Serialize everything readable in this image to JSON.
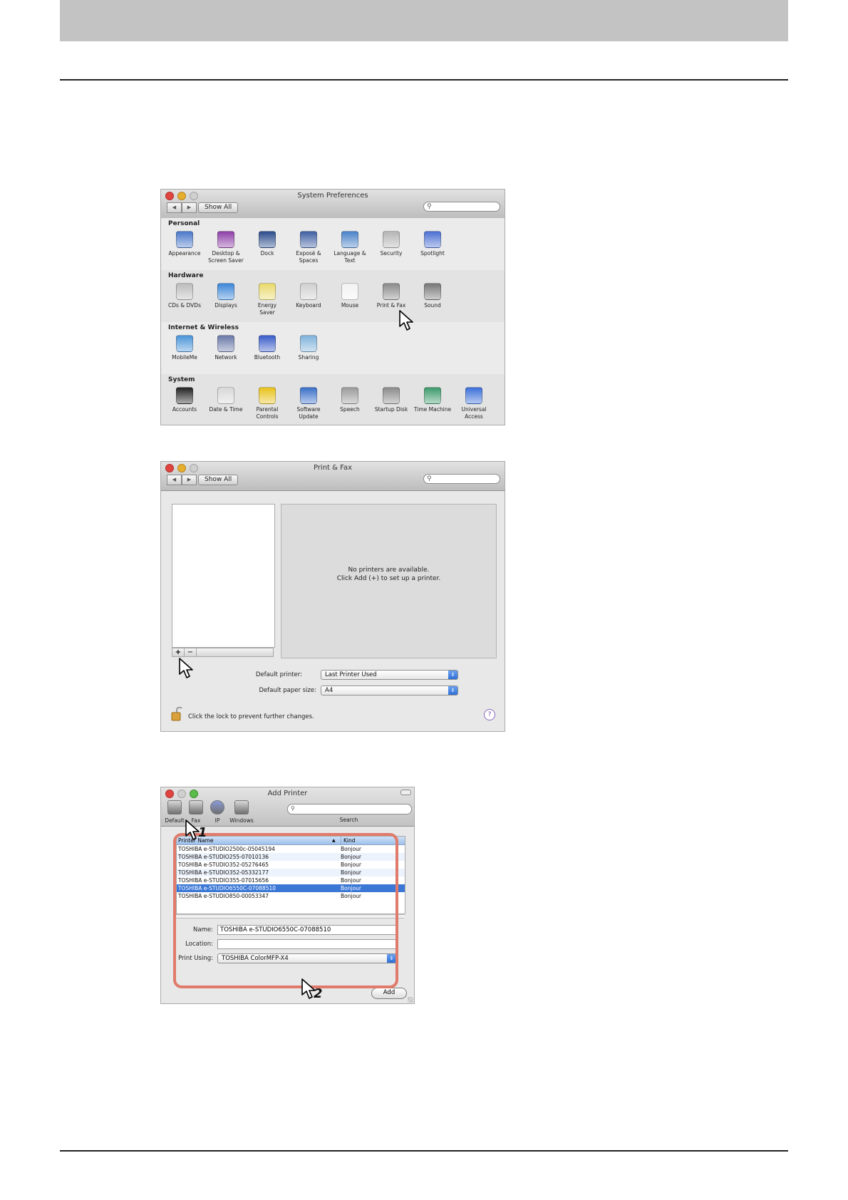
{
  "sys_prefs": {
    "title": "System Preferences",
    "show_all": "Show All",
    "sections": [
      {
        "name": "Personal",
        "items": [
          {
            "label": "Appearance",
            "icon": "appearance-icon",
            "color": "#4a78c8"
          },
          {
            "label": "Desktop &\nScreen Saver",
            "icon": "desktop-icon",
            "color": "#8e3fa8"
          },
          {
            "label": "Dock",
            "icon": "dock-icon",
            "color": "#2b4c8c"
          },
          {
            "label": "Exposé &\nSpaces",
            "icon": "expose-icon",
            "color": "#3f5fa3"
          },
          {
            "label": "Language &\nText",
            "icon": "flag-icon",
            "color": "#4a82c8"
          },
          {
            "label": "Security",
            "icon": "house-lock-icon",
            "color": "#b5b5b5"
          },
          {
            "label": "Spotlight",
            "icon": "spotlight-icon",
            "color": "#4b70d2"
          }
        ]
      },
      {
        "name": "Hardware",
        "items": [
          {
            "label": "CDs & DVDs",
            "icon": "disc-icon",
            "color": "#bcbcbc"
          },
          {
            "label": "Displays",
            "icon": "display-icon",
            "color": "#3b86d8"
          },
          {
            "label": "Energy\nSaver",
            "icon": "bulb-icon",
            "color": "#e8d96a"
          },
          {
            "label": "Keyboard",
            "icon": "keyboard-icon",
            "color": "#cfcfcf"
          },
          {
            "label": "Mouse",
            "icon": "mouse-icon",
            "color": "#f2f2f2"
          },
          {
            "label": "Print & Fax",
            "icon": "printer-icon",
            "color": "#8a8a8a"
          },
          {
            "label": "Sound",
            "icon": "speaker-icon",
            "color": "#777777"
          }
        ]
      },
      {
        "name": "Internet & Wireless",
        "items": [
          {
            "label": "MobileMe",
            "icon": "cloud-icon",
            "color": "#4a95d8"
          },
          {
            "label": "Network",
            "icon": "globe-icon",
            "color": "#6a78a8"
          },
          {
            "label": "Bluetooth",
            "icon": "bluetooth-icon",
            "color": "#3a5cc8"
          },
          {
            "label": "Sharing",
            "icon": "folder-icon",
            "color": "#7fb2da"
          }
        ]
      },
      {
        "name": "System",
        "items": [
          {
            "label": "Accounts",
            "icon": "users-icon",
            "color": "#222222"
          },
          {
            "label": "Date & Time",
            "icon": "clock-icon",
            "color": "#d8d8d8"
          },
          {
            "label": "Parental\nControls",
            "icon": "parental-icon",
            "color": "#e8c21a"
          },
          {
            "label": "Software\nUpdate",
            "icon": "update-icon",
            "color": "#3a6fc8"
          },
          {
            "label": "Speech",
            "icon": "microphone-icon",
            "color": "#9a9a9a"
          },
          {
            "label": "Startup Disk",
            "icon": "disk-icon",
            "color": "#8a8a8a"
          },
          {
            "label": "Time Machine",
            "icon": "time-machine-icon",
            "color": "#3d9a6b"
          },
          {
            "label": "Universal\nAccess",
            "icon": "accessibility-icon",
            "color": "#3a6fd8"
          }
        ]
      }
    ]
  },
  "print_fax": {
    "title": "Print & Fax",
    "show_all": "Show All",
    "empty_line1": "No printers are available.",
    "empty_line2": "Click Add (+) to set up a printer.",
    "add_btn": "+",
    "remove_btn": "−",
    "default_printer_label": "Default printer:",
    "default_printer_value": "Last Printer Used",
    "paper_size_label": "Default paper size:",
    "paper_size_value": "A4",
    "lock_text": "Click the lock to prevent further changes.",
    "help_btn": "?"
  },
  "add_printer": {
    "title": "Add Printer",
    "toolbar": [
      {
        "label": "Default",
        "icon": "printer-icon"
      },
      {
        "label": "Fax",
        "icon": "fax-icon"
      },
      {
        "label": "IP",
        "icon": "globe-icon"
      },
      {
        "label": "Windows",
        "icon": "windows-printer-icon"
      }
    ],
    "search_label": "Search",
    "col_name": "Printer Name",
    "col_kind": "Kind",
    "rows": [
      {
        "name": "TOSHIBA e-STUDIO2500c-05045194",
        "kind": "Bonjour"
      },
      {
        "name": "TOSHIBA e-STUDIO255-07010136",
        "kind": "Bonjour"
      },
      {
        "name": "TOSHIBA e-STUDIO352-05276465",
        "kind": "Bonjour"
      },
      {
        "name": "TOSHIBA e-STUDIO352-05332177",
        "kind": "Bonjour"
      },
      {
        "name": "TOSHIBA e-STUDIO355-07015656",
        "kind": "Bonjour"
      },
      {
        "name": "TOSHIBA e-STUDIO6550C-07088510",
        "kind": "Bonjour"
      },
      {
        "name": "TOSHIBA e-STUDIO850-00053347",
        "kind": "Bonjour"
      }
    ],
    "selected_row": 5,
    "name_label": "Name:",
    "name_value": "TOSHIBA e-STUDIO6550C-07088510",
    "location_label": "Location:",
    "location_value": "",
    "print_using_label": "Print Using:",
    "print_using_value": "TOSHIBA ColorMFP-X4",
    "add_btn": "Add",
    "callout_1": "1",
    "callout_2": "2",
    "highlight_color": "#e07a6a"
  }
}
